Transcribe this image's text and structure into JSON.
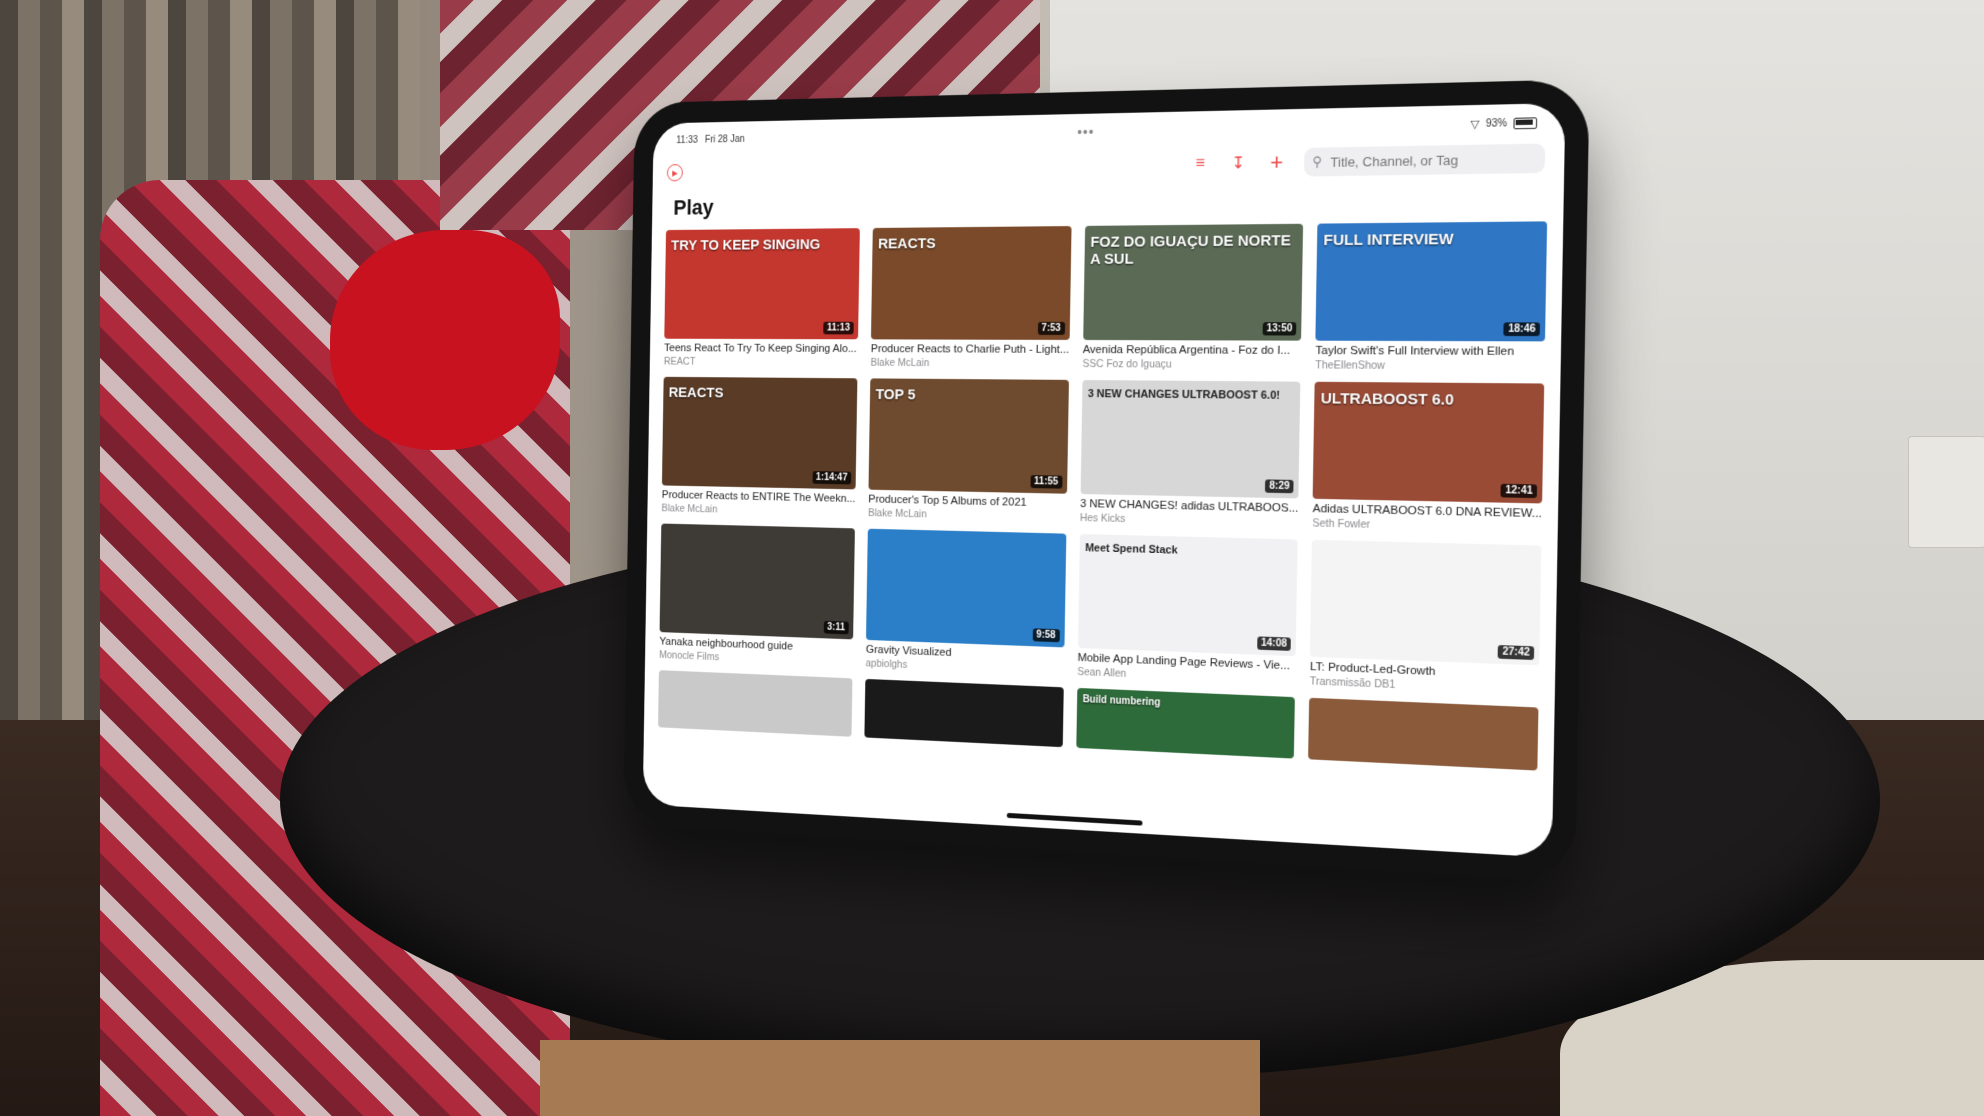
{
  "status_bar": {
    "time": "11:33",
    "date": "Fri 28 Jan",
    "battery": "93%"
  },
  "toolbar": {
    "search_placeholder": "Title, Channel, or Tag",
    "icons": [
      "play-logo-icon",
      "filter-icon",
      "import-icon",
      "plus-icon",
      "search-icon"
    ]
  },
  "page": {
    "title": "Play"
  },
  "videos": [
    {
      "title": "Teens React To Try To Keep Singing Alo...",
      "channel": "REACT",
      "duration": "11:13",
      "thumb_text": "TRY TO KEEP SINGING",
      "color": "#c4372e"
    },
    {
      "title": "Producer Reacts to Charlie Puth - Light...",
      "channel": "Blake McLain",
      "duration": "7:53",
      "thumb_text": "REACTS",
      "color": "#7a4a2a"
    },
    {
      "title": "Avenida República Argentina - Foz do I...",
      "channel": "SSC Foz do Iguaçu",
      "duration": "13:50",
      "thumb_text": "FOZ DO IGUAÇU DE NORTE A SUL",
      "color": "#5b6a55"
    },
    {
      "title": "Taylor Swift's Full Interview with Ellen",
      "channel": "TheEllenShow",
      "duration": "18:46",
      "thumb_text": "FULL INTERVIEW",
      "color": "#2f76c4"
    },
    {
      "title": "Producer Reacts to ENTIRE The Weekn...",
      "channel": "Blake McLain",
      "duration": "1:14:47",
      "thumb_text": "REACTS",
      "color": "#5a3b26"
    },
    {
      "title": "Producer's Top 5 Albums of 2021",
      "channel": "Blake McLain",
      "duration": "11:55",
      "thumb_text": "TOP 5",
      "color": "#6e4a2e"
    },
    {
      "title": "3 NEW CHANGES! adidas ULTRABOOS...",
      "channel": "Hes Kicks",
      "duration": "8:29",
      "thumb_text": "3 NEW CHANGES ULTRABOOST 6.0!",
      "color": "#d7d7d7"
    },
    {
      "title": "Adidas ULTRABOOST 6.0 DNA REVIEW...",
      "channel": "Seth Fowler",
      "duration": "12:41",
      "thumb_text": "ULTRABOOST 6.0",
      "color": "#9a4b36"
    },
    {
      "title": "Yanaka neighbourhood guide",
      "channel": "Monocle Films",
      "duration": "3:11",
      "thumb_text": "",
      "color": "#3e3a35"
    },
    {
      "title": "Gravity Visualized",
      "channel": "apbiolghs",
      "duration": "9:58",
      "thumb_text": "",
      "color": "#2b7fc8"
    },
    {
      "title": "Mobile App Landing Page Reviews - Vie...",
      "channel": "Sean Allen",
      "duration": "14:08",
      "thumb_text": "Meet Spend Stack",
      "color": "#f1f1f3"
    },
    {
      "title": "LT:  Product-Led-Growth",
      "channel": "Transmissão DB1",
      "duration": "27:42",
      "thumb_text": "",
      "color": "#f4f4f4"
    }
  ],
  "partial_row_thumbs": [
    {
      "thumb_text": "",
      "color": "#c9c9c9"
    },
    {
      "thumb_text": "",
      "color": "#1a1a1a"
    },
    {
      "thumb_text": "Build numbering",
      "color": "#2e6b3a"
    },
    {
      "thumb_text": "",
      "color": "#8a5a3a"
    }
  ]
}
